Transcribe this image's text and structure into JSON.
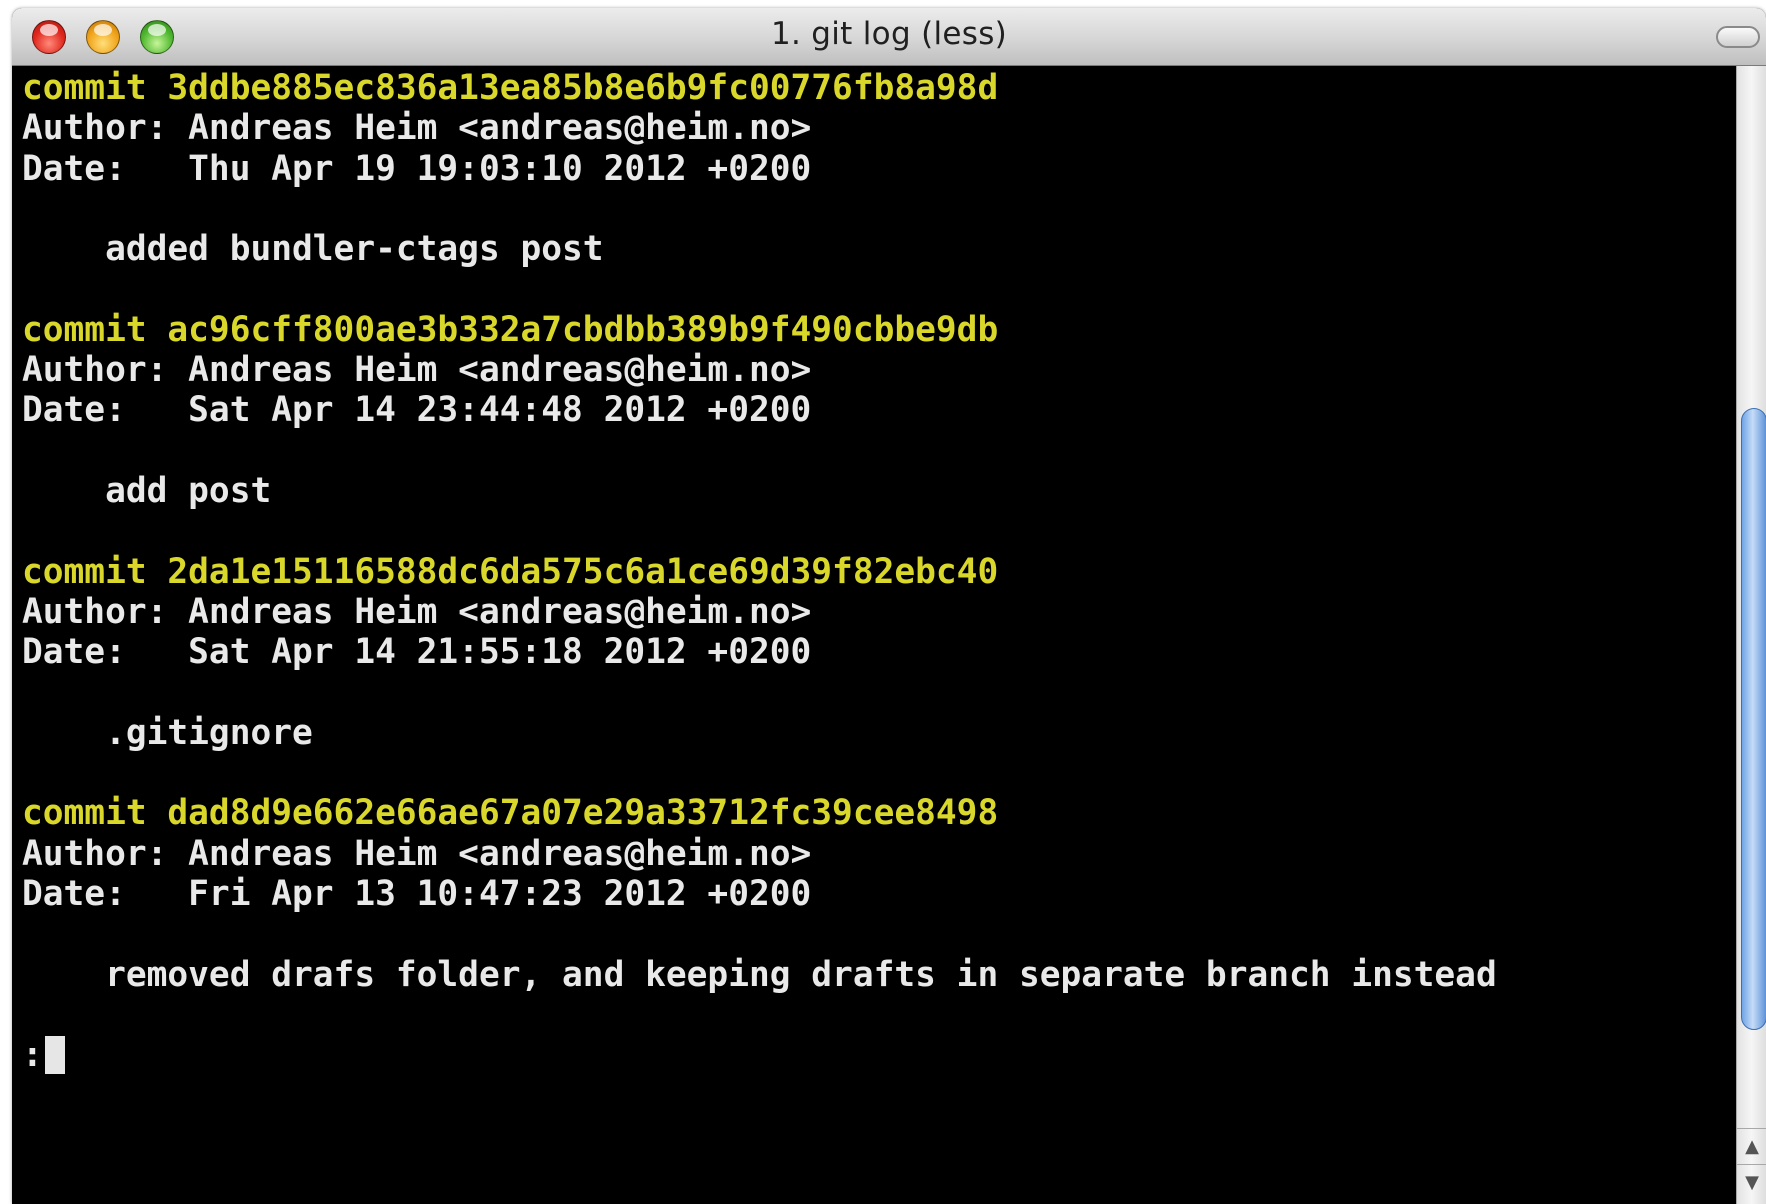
{
  "window": {
    "title": "1. git log (less)"
  },
  "colors": {
    "commit_line": "#d9d72a",
    "text": "#e9e9e9",
    "background": "#000000"
  },
  "terminal": {
    "commits": [
      {
        "commit_line": "commit 3ddbe885ec836a13ea85b8e6b9fc00776fb8a98d",
        "author_line": "Author: Andreas Heim <andreas@heim.no>",
        "date_line": "Date:   Thu Apr 19 19:03:10 2012 +0200",
        "message_line": "    added bundler-ctags post"
      },
      {
        "commit_line": "commit ac96cff800ae3b332a7cbdbb389b9f490cbbe9db",
        "author_line": "Author: Andreas Heim <andreas@heim.no>",
        "date_line": "Date:   Sat Apr 14 23:44:48 2012 +0200",
        "message_line": "    add post"
      },
      {
        "commit_line": "commit 2da1e15116588dc6da575c6a1ce69d39f82ebc40",
        "author_line": "Author: Andreas Heim <andreas@heim.no>",
        "date_line": "Date:   Sat Apr 14 21:55:18 2012 +0200",
        "message_line": "    .gitignore"
      },
      {
        "commit_line": "commit dad8d9e662e66ae67a07e29a33712fc39cee8498",
        "author_line": "Author: Andreas Heim <andreas@heim.no>",
        "date_line": "Date:   Fri Apr 13 10:47:23 2012 +0200",
        "message_line": "    removed drafs folder, and keeping drafts in separate branch instead"
      }
    ],
    "prompt": ":"
  },
  "icons": {
    "close": "close-button-icon",
    "minimize": "minimize-button-icon",
    "zoom": "zoom-button-icon",
    "toolbar": "toolbar-toggle-icon",
    "scroll_up": "scroll-up-arrow-icon",
    "scroll_down": "scroll-down-arrow-icon"
  }
}
